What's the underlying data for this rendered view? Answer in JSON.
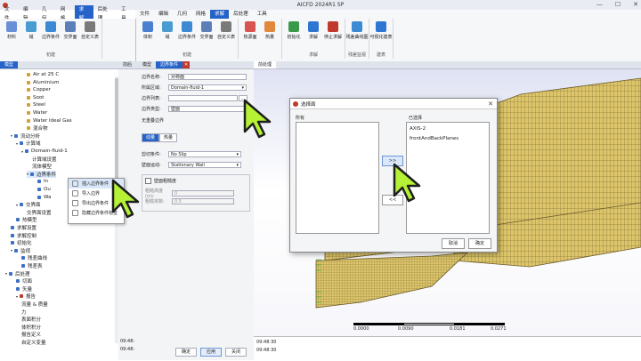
{
  "app": {
    "title": "AICFD 2024R1 SP"
  },
  "colors": {
    "accent": "#2563c9",
    "mesh": "#d9c466",
    "meshLine": "#6b5a2a",
    "cursor": "#b5f135"
  },
  "menu_left": {
    "tabs": [
      "文件",
      "编辑",
      "几何",
      "网格",
      "求解",
      "后处理",
      "工具"
    ],
    "active": 4
  },
  "menu_right": {
    "tabs": [
      "文件",
      "编辑",
      "几何",
      "网格",
      "求解",
      "后处理",
      "工具"
    ],
    "active": 4
  },
  "ribbon_left": {
    "groups": [
      {
        "label": "",
        "buttons": [
          {
            "label": "材料",
            "icon": "material-icon",
            "color": "#6a8fd6"
          },
          {
            "label": "域",
            "icon": "domain-icon",
            "color": "#4a9bd1"
          },
          {
            "label": "边界条件",
            "icon": "boundary-icon",
            "color": "#3c8ad3"
          },
          {
            "label": "交界面",
            "icon": "interface-icon",
            "color": "#5d7fb8"
          },
          {
            "label": "自定义表",
            "icon": "table-icon",
            "color": "#7a7a7a"
          }
        ],
        "group_label": "初建"
      }
    ]
  },
  "ribbon_right": {
    "groups": [
      {
        "buttons": [
          {
            "label": "体积",
            "icon": "volume-icon",
            "color": "#4a7ed1"
          },
          {
            "label": "域",
            "icon": "domain-icon",
            "color": "#4a9bd1"
          },
          {
            "label": "边界条件",
            "icon": "boundary-icon",
            "color": "#3c8ad3"
          },
          {
            "label": "交界面",
            "icon": "interface-icon",
            "color": "#5d7fb8"
          },
          {
            "label": "自定义表",
            "icon": "table-icon",
            "color": "#7a7a7a"
          }
        ],
        "group_label": "初建"
      },
      {
        "buttons": [
          {
            "label": "热源面",
            "icon": "heat-source-icon",
            "color": "#d9534f"
          },
          {
            "label": "热量",
            "icon": "heat-icon",
            "color": "#e0893a"
          }
        ],
        "group_label": ""
      },
      {
        "buttons": [
          {
            "label": "初始化",
            "icon": "init-icon",
            "color": "#3a9a4a"
          },
          {
            "label": "求解",
            "icon": "solve-icon",
            "color": "#2f76d2"
          },
          {
            "label": "停止求解",
            "icon": "stop-icon",
            "color": "#c0392b"
          }
        ],
        "group_label": "求解"
      },
      {
        "buttons": [
          {
            "label": "残差曲线图",
            "icon": "residual-icon",
            "color": "#3c8ad3"
          }
        ],
        "group_label": "残差监视"
      },
      {
        "buttons": [
          {
            "label": "可视化建表",
            "icon": "viz-icon",
            "color": "#2f76d2"
          }
        ],
        "group_label": "建表"
      }
    ]
  },
  "tree": {
    "tab": "模型",
    "items": [
      {
        "label": "Air at 25 C",
        "indent": 4,
        "color": "#d0a03c"
      },
      {
        "label": "Aluminium",
        "indent": 4,
        "color": "#d0a03c"
      },
      {
        "label": "Copper",
        "indent": 4,
        "color": "#d0a03c"
      },
      {
        "label": "Soot",
        "indent": 4,
        "color": "#d0a03c"
      },
      {
        "label": "Steel",
        "indent": 4,
        "color": "#d0a03c"
      },
      {
        "label": "Water",
        "indent": 4,
        "color": "#d0a03c"
      },
      {
        "label": "Water Ideal Gas",
        "indent": 4,
        "color": "#d0a03c"
      },
      {
        "label": "混合物",
        "indent": 4,
        "color": "#d0a03c"
      },
      {
        "label": "流动分析",
        "indent": 1,
        "color": "#3c6fc8",
        "caret": "▾"
      },
      {
        "label": "计算域",
        "indent": 2,
        "color": "#3c6fc8",
        "caret": "▾"
      },
      {
        "label": "Domain-fluid-1",
        "indent": 3,
        "color": "#3c6fc8",
        "caret": "▾"
      },
      {
        "label": "计算域设置",
        "indent": 5,
        "color": ""
      },
      {
        "label": "流体模型",
        "indent": 5,
        "color": ""
      },
      {
        "label": "边界条件",
        "indent": 4,
        "color": "#3c6fc8",
        "caret": "▾",
        "selected": true
      },
      {
        "label": "In",
        "indent": 6,
        "color": "#3c6fc8"
      },
      {
        "label": "Ou",
        "indent": 6,
        "color": "#3c6fc8"
      },
      {
        "label": "Wa",
        "indent": 6,
        "color": "#3c6fc8"
      },
      {
        "label": "交界面",
        "indent": 2,
        "color": "#3c6fc8",
        "caret": "▾"
      },
      {
        "label": "交界面设置",
        "indent": 4,
        "color": ""
      },
      {
        "label": "热模型",
        "indent": 2,
        "color": "#3c6fc8"
      },
      {
        "label": "求解设置",
        "indent": 1,
        "color": "#3c6fc8"
      },
      {
        "label": "求解控制",
        "indent": 1,
        "color": "#3c6fc8"
      },
      {
        "label": "初始化",
        "indent": 1,
        "color": "#3c6fc8"
      },
      {
        "label": "监视",
        "indent": 1,
        "color": "#3c6fc8",
        "caret": "▾"
      },
      {
        "label": "残差曲线",
        "indent": 3,
        "color": "#3c6fc8"
      },
      {
        "label": "残差表",
        "indent": 3,
        "color": "#3c6fc8"
      },
      {
        "label": "后处理",
        "indent": 0,
        "color": "#3c6fc8",
        "caret": "▾"
      },
      {
        "label": "切面",
        "indent": 2,
        "color": "#3c6fc8"
      },
      {
        "label": "矢量",
        "indent": 2,
        "color": "#3c6fc8"
      },
      {
        "label": "报告",
        "indent": 2,
        "color": "#c0392b",
        "caret": "▾"
      },
      {
        "label": "流量 & 质量",
        "indent": 3,
        "color": ""
      },
      {
        "label": "力",
        "indent": 3,
        "color": ""
      },
      {
        "label": "表面积分",
        "indent": 3,
        "color": ""
      },
      {
        "label": "体积积分",
        "indent": 3,
        "color": ""
      },
      {
        "label": "报告定义",
        "indent": 3,
        "color": ""
      },
      {
        "label": "自定义变量",
        "indent": 3,
        "color": ""
      }
    ]
  },
  "context_menu": {
    "items": [
      "插入边界条件",
      "导入边界",
      "导出边界条件",
      "隐藏边界条件标签"
    ],
    "highlighted": 0
  },
  "props_tabs": {
    "tabs": [
      "模型",
      "边界条件"
    ],
    "active": 1
  },
  "viewport_tab": "前处理",
  "props": {
    "name_label": "边界名称:",
    "name_value": "对称面",
    "region_label": "所属区域:",
    "region_value": "Domain-fluid-1",
    "list_label": "边界列表:",
    "list_value": "",
    "type_label": "边界类型:",
    "type_value": "壁面",
    "nonoverlap_label": "无重叠边界",
    "subtabs": [
      "动量",
      "热量"
    ],
    "shear_label": "剪切条件:",
    "shear_value": "No Slip",
    "motion_label": "壁面运动:",
    "motion_value": "Stationary Wall",
    "roughness_label": "壁面粗糙度",
    "rough_h_label": "粗糙高度(m):",
    "rough_h_value": "0",
    "rough_c_label": "粗糙常数:",
    "rough_c_value": "0.5",
    "buttons": [
      "确定",
      "应用",
      "关闭"
    ]
  },
  "dialog": {
    "title": "选择面",
    "left_header": "所有",
    "right_header": "已选择",
    "selected_items": [
      "AXIS-2",
      "frontAndBackPlanes"
    ],
    "add_btn": ">>",
    "remove_btn": "<<",
    "cancel": "取消",
    "ok": "确定"
  },
  "scale_labels": [
    "0.0000",
    "0.0090",
    "0.0181",
    "0.0271"
  ],
  "log_left": [
    "09:48:",
    "09:48:"
  ],
  "log_right": [
    "09:48:30",
    "09:48:30"
  ]
}
